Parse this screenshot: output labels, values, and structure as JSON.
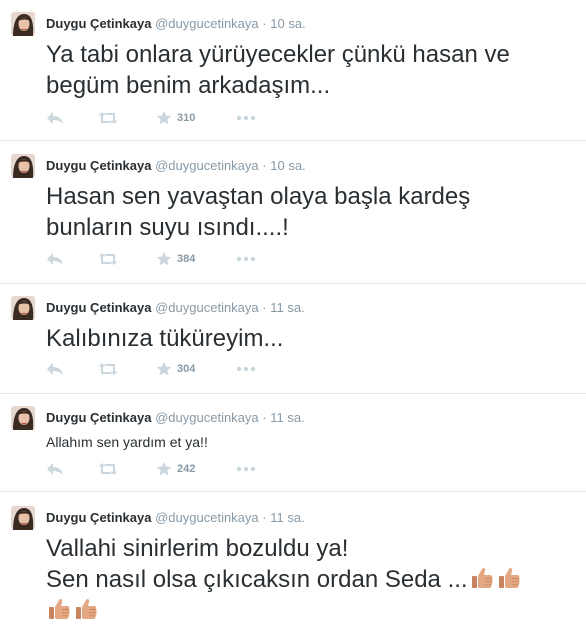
{
  "tweets": [
    {
      "name": "Duygu Çetinkaya",
      "handle": "@duygucetinkaya",
      "separator": "·",
      "time": "10 sa.",
      "text": "Ya tabi onlara yürüyecekler çünkü hasan ve begüm benim arkadaşım...",
      "favorites": "310"
    },
    {
      "name": "Duygu Çetinkaya",
      "handle": "@duygucetinkaya",
      "separator": "·",
      "time": "10 sa.",
      "text": "Hasan sen yavaştan olaya başla kardeş bunların suyu ısındı....!",
      "favorites": "384"
    },
    {
      "name": "Duygu Çetinkaya",
      "handle": "@duygucetinkaya",
      "separator": "·",
      "time": "11 sa.",
      "text": "Kalıbınıza tüküreyim...",
      "favorites": "304"
    },
    {
      "name": "Duygu Çetinkaya",
      "handle": "@duygucetinkaya",
      "separator": "·",
      "time": "11 sa.",
      "text": "Allahım sen yardım et ya!!",
      "favorites": "242"
    },
    {
      "name": "Duygu Çetinkaya",
      "handle": "@duygucetinkaya",
      "separator": "·",
      "time": "11 sa.",
      "text_line1": "Vallahi sinirlerim bozuldu ya!",
      "text_line2": "Sen nasıl olsa çıkıcaksın ordan Seda ...",
      "emoji": "thumbs-up-emoji"
    }
  ],
  "icons": {
    "reply": "reply-icon",
    "retweet": "retweet-icon",
    "favorite": "star-icon",
    "more": "more-icon"
  },
  "colors": {
    "text": "#292f33",
    "muted": "#8899a6",
    "icon": "#ccd6dd",
    "divider": "#e1e8ed",
    "emoji": "#d9a27e"
  }
}
